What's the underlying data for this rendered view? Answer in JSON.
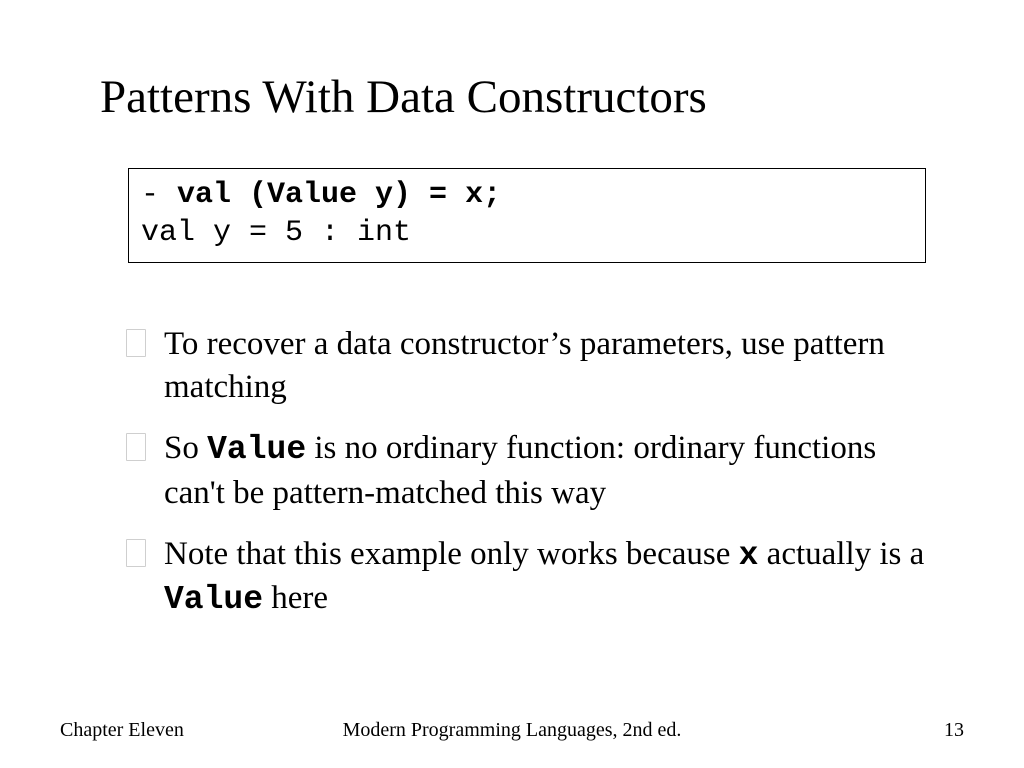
{
  "title": "Patterns With Data Constructors",
  "code": {
    "prompt": "- ",
    "line1_bold": "val (Value y) = x;",
    "line2": "val y = 5 : int"
  },
  "bullets": [
    {
      "pre": "To recover a data constructor’s parameters, use pattern matching"
    },
    {
      "pre": "So ",
      "mono1": "Value",
      "mid": " is no ordinary function: ordinary functions can't be pattern-matched this way"
    },
    {
      "pre": "Note that this example only works because ",
      "mono1": "x",
      "mid": " actually is a ",
      "mono2": "Value",
      "post": " here"
    }
  ],
  "footer": {
    "left": "Chapter Eleven",
    "center": "Modern Programming Languages, 2nd ed.",
    "right": "13"
  }
}
